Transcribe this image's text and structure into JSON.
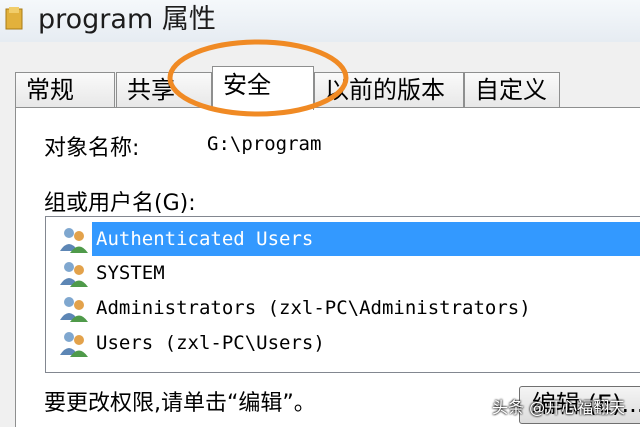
{
  "window": {
    "title": "program 属性"
  },
  "tabs": [
    {
      "label": "常规",
      "active": false
    },
    {
      "label": "共享",
      "active": false
    },
    {
      "label": "安全",
      "active": true
    },
    {
      "label": "以前的版本",
      "active": false
    },
    {
      "label": "自定义",
      "active": false
    }
  ],
  "security": {
    "object_name_label": "对象名称:",
    "object_name_value": "G:\\program",
    "groups_label": "组或用户名(G):",
    "users": [
      {
        "name": "Authenticated Users",
        "selected": true
      },
      {
        "name": "SYSTEM",
        "selected": false
      },
      {
        "name": "Administrators (zxl-PC\\Administrators)",
        "selected": false
      },
      {
        "name": "Users (zxl-PC\\Users)",
        "selected": false
      }
    ],
    "change_perm_text": "要更改权限,请单击“编辑”。",
    "edit_button_label": "编辑 (E)..."
  },
  "watermark": "头条 @开心福翻天",
  "colors": {
    "selection": "#3399ff",
    "highlight_ring": "#f08a24"
  },
  "icons": {
    "window": "folder-icon",
    "user": "users-group-icon"
  }
}
